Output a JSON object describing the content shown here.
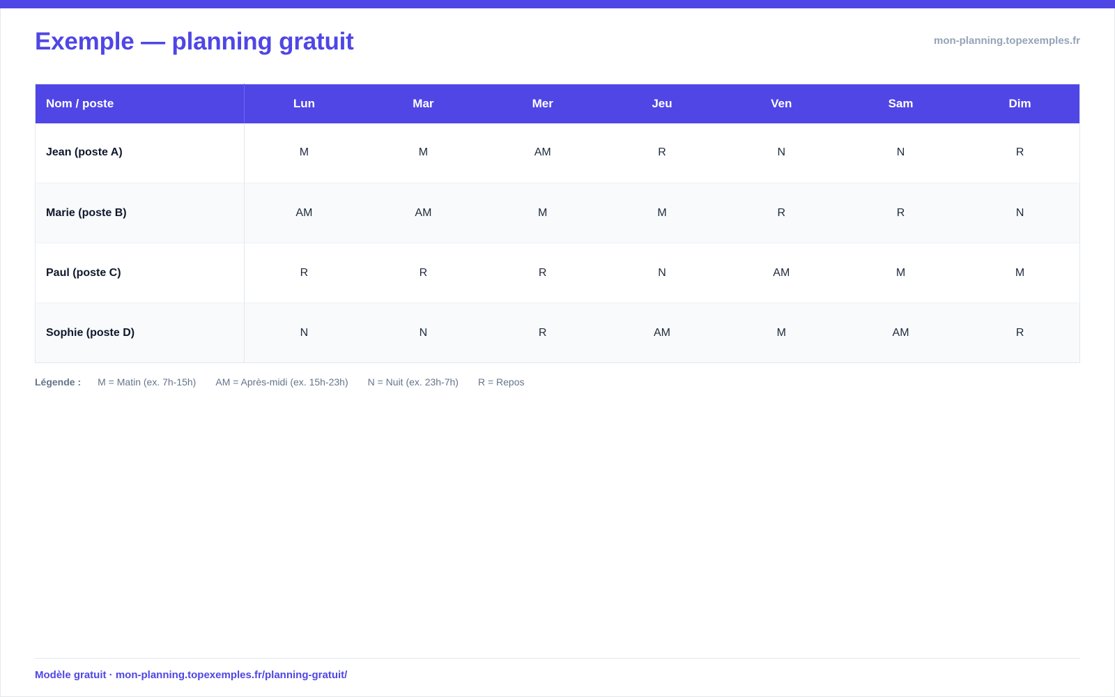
{
  "header": {
    "title": "Exemple — planning gratuit",
    "site": "mon-planning.topexemples.fr"
  },
  "table": {
    "columns": [
      "Nom / poste",
      "Lun",
      "Mar",
      "Mer",
      "Jeu",
      "Ven",
      "Sam",
      "Dim"
    ],
    "rows": [
      {
        "name": "Jean (poste A)",
        "shifts": [
          "M",
          "M",
          "AM",
          "R",
          "N",
          "N",
          "R"
        ]
      },
      {
        "name": "Marie (poste B)",
        "shifts": [
          "AM",
          "AM",
          "M",
          "M",
          "R",
          "R",
          "N"
        ]
      },
      {
        "name": "Paul (poste C)",
        "shifts": [
          "R",
          "R",
          "R",
          "N",
          "AM",
          "M",
          "M"
        ]
      },
      {
        "name": "Sophie (poste D)",
        "shifts": [
          "N",
          "N",
          "R",
          "AM",
          "M",
          "AM",
          "R"
        ]
      }
    ]
  },
  "legend": {
    "label": "Légende :",
    "items": [
      "M = Matin (ex. 7h-15h)",
      "AM = Après-midi (ex. 15h-23h)",
      "N = Nuit (ex. 23h-7h)",
      "R = Repos"
    ]
  },
  "footer": {
    "text": "Modèle gratuit · mon-planning.topexemples.fr/planning-gratuit/"
  },
  "colors": {
    "accent": "#4f46e5",
    "muted": "#94a3b8",
    "row_alt": "#f8fafc"
  }
}
